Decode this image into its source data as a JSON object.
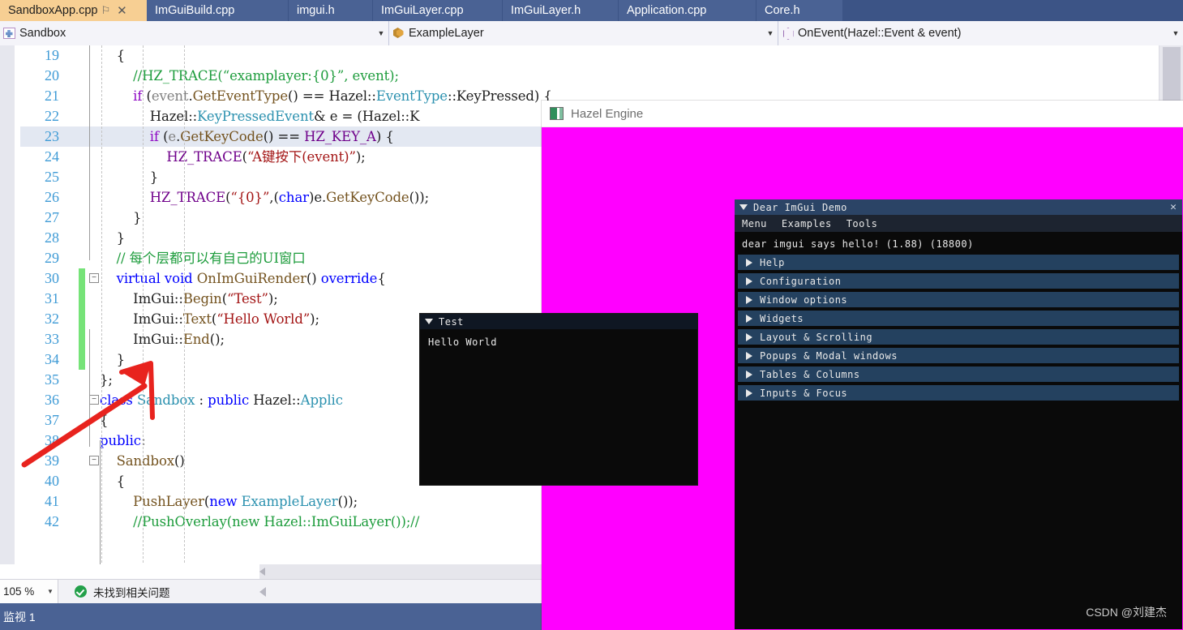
{
  "tabs": [
    {
      "label": "SandboxApp.cpp",
      "active": true,
      "pin": "⚐",
      "close": "✕"
    },
    {
      "label": "ImGuiBuild.cpp",
      "active": false
    },
    {
      "label": "imgui.h",
      "active": false
    },
    {
      "label": "ImGuiLayer.cpp",
      "active": false
    },
    {
      "label": "ImGuiLayer.h",
      "active": false
    },
    {
      "label": "Application.cpp",
      "active": false
    },
    {
      "label": "Core.h",
      "active": false
    }
  ],
  "navbar": {
    "project": {
      "label": "Sandbox",
      "icon": "project-icon",
      "arrow": "▼"
    },
    "class": {
      "label": "ExampleLayer",
      "icon": "class-icon",
      "arrow": "▼"
    },
    "member": {
      "label": "OnEvent(Hazel::Event & event)",
      "icon": "method-icon",
      "arrow": "▼"
    }
  },
  "editor": {
    "lines": [
      {
        "num": "19",
        "indent": 0,
        "fold": "",
        "change": "",
        "highlight": false,
        "tokens": [
          {
            "t": "    {",
            "c": "t-pl"
          }
        ]
      },
      {
        "num": "20",
        "indent": 0,
        "fold": "",
        "change": "",
        "highlight": false,
        "tokens": [
          {
            "t": "        //HZ_TRACE(“examplayer:{0}”, event);",
            "c": "t-cmt"
          }
        ]
      },
      {
        "num": "21",
        "indent": 0,
        "fold": "",
        "change": "",
        "highlight": false,
        "tokens": [
          {
            "t": "        ",
            "c": "t-pl"
          },
          {
            "t": "if",
            "c": "t-ctl"
          },
          {
            "t": " (",
            "c": "t-pl"
          },
          {
            "t": "event",
            "c": "t-var"
          },
          {
            "t": ".",
            "c": "t-pl"
          },
          {
            "t": "GetEventType",
            "c": "t-fn"
          },
          {
            "t": "() == Hazel::",
            "c": "t-pl"
          },
          {
            "t": "EventType",
            "c": "t-type"
          },
          {
            "t": "::KeyPressed) {",
            "c": "t-pl"
          }
        ]
      },
      {
        "num": "22",
        "indent": 0,
        "fold": "",
        "change": "",
        "highlight": false,
        "tokens": [
          {
            "t": "            Hazel::",
            "c": "t-pl"
          },
          {
            "t": "KeyPressedEvent",
            "c": "t-type"
          },
          {
            "t": "& e = (Hazel::K",
            "c": "t-pl"
          }
        ]
      },
      {
        "num": "23",
        "indent": 0,
        "fold": "",
        "change": "",
        "highlight": true,
        "tokens": [
          {
            "t": "            ",
            "c": "t-pl"
          },
          {
            "t": "if",
            "c": "t-ctl"
          },
          {
            "t": " (",
            "c": "t-pl"
          },
          {
            "t": "e",
            "c": "t-var"
          },
          {
            "t": ".",
            "c": "t-pl"
          },
          {
            "t": "GetKeyCode",
            "c": "t-fn"
          },
          {
            "t": "() == ",
            "c": "t-pl"
          },
          {
            "t": "HZ_KEY_A",
            "c": "t-mac"
          },
          {
            "t": ") {",
            "c": "t-pl"
          }
        ]
      },
      {
        "num": "24",
        "indent": 0,
        "fold": "",
        "change": "",
        "highlight": false,
        "tokens": [
          {
            "t": "                ",
            "c": "t-pl"
          },
          {
            "t": "HZ_TRACE",
            "c": "t-mac"
          },
          {
            "t": "(",
            "c": "t-pl"
          },
          {
            "t": "“A键按下(event)”",
            "c": "t-str"
          },
          {
            "t": ");",
            "c": "t-pl"
          }
        ]
      },
      {
        "num": "25",
        "indent": 0,
        "fold": "",
        "change": "",
        "highlight": false,
        "tokens": [
          {
            "t": "            }",
            "c": "t-pl"
          }
        ]
      },
      {
        "num": "26",
        "indent": 0,
        "fold": "",
        "change": "",
        "highlight": false,
        "tokens": [
          {
            "t": "            ",
            "c": "t-pl"
          },
          {
            "t": "HZ_TRACE",
            "c": "t-mac"
          },
          {
            "t": "(",
            "c": "t-pl"
          },
          {
            "t": "“{0}”",
            "c": "t-str"
          },
          {
            "t": ",(",
            "c": "t-pl"
          },
          {
            "t": "char",
            "c": "t-kw"
          },
          {
            "t": ")e.",
            "c": "t-pl"
          },
          {
            "t": "GetKeyCode",
            "c": "t-fn"
          },
          {
            "t": "());",
            "c": "t-pl"
          }
        ]
      },
      {
        "num": "27",
        "indent": 0,
        "fold": "",
        "change": "",
        "highlight": false,
        "tokens": [
          {
            "t": "        }",
            "c": "t-pl"
          }
        ]
      },
      {
        "num": "28",
        "indent": 0,
        "fold": "",
        "change": "",
        "highlight": false,
        "tokens": [
          {
            "t": "    }",
            "c": "t-pl"
          }
        ]
      },
      {
        "num": "29",
        "indent": 0,
        "fold": "",
        "change": "",
        "highlight": false,
        "tokens": [
          {
            "t": "    // 每个层都可以有自己的UI窗口",
            "c": "t-cmt"
          }
        ]
      },
      {
        "num": "30",
        "indent": 0,
        "fold": "−",
        "change": "green",
        "highlight": false,
        "tokens": [
          {
            "t": "    ",
            "c": "t-pl"
          },
          {
            "t": "virtual",
            "c": "t-kw"
          },
          {
            "t": " ",
            "c": "t-pl"
          },
          {
            "t": "void",
            "c": "t-kw"
          },
          {
            "t": " ",
            "c": "t-pl"
          },
          {
            "t": "OnImGuiRender",
            "c": "t-fn"
          },
          {
            "t": "() ",
            "c": "t-pl"
          },
          {
            "t": "override",
            "c": "t-kw"
          },
          {
            "t": "{",
            "c": "t-pl"
          }
        ]
      },
      {
        "num": "31",
        "indent": 0,
        "fold": "",
        "change": "green",
        "highlight": false,
        "tokens": [
          {
            "t": "        ImGui::",
            "c": "t-pl"
          },
          {
            "t": "Begin",
            "c": "t-fn"
          },
          {
            "t": "(",
            "c": "t-pl"
          },
          {
            "t": "“Test”",
            "c": "t-str"
          },
          {
            "t": ");",
            "c": "t-pl"
          }
        ]
      },
      {
        "num": "32",
        "indent": 0,
        "fold": "",
        "change": "green",
        "highlight": false,
        "tokens": [
          {
            "t": "        ImGui::",
            "c": "t-pl"
          },
          {
            "t": "Text",
            "c": "t-fn"
          },
          {
            "t": "(",
            "c": "t-pl"
          },
          {
            "t": "“Hello World”",
            "c": "t-str"
          },
          {
            "t": ");",
            "c": "t-pl"
          }
        ]
      },
      {
        "num": "33",
        "indent": 0,
        "fold": "",
        "change": "green",
        "highlight": false,
        "tokens": [
          {
            "t": "        ImGui::",
            "c": "t-pl"
          },
          {
            "t": "End",
            "c": "t-fn"
          },
          {
            "t": "();",
            "c": "t-pl"
          }
        ]
      },
      {
        "num": "34",
        "indent": 0,
        "fold": "",
        "change": "green",
        "highlight": false,
        "tokens": [
          {
            "t": "    }",
            "c": "t-pl"
          }
        ]
      },
      {
        "num": "35",
        "indent": 0,
        "fold": "",
        "change": "",
        "highlight": false,
        "tokens": [
          {
            "t": "};",
            "c": "t-pl"
          }
        ]
      },
      {
        "num": "36",
        "indent": 0,
        "fold": "−",
        "change": "",
        "highlight": false,
        "tokens": [
          {
            "t": "",
            "c": "t-pl"
          },
          {
            "t": "class",
            "c": "t-kw"
          },
          {
            "t": " ",
            "c": "t-pl"
          },
          {
            "t": "Sandbox",
            "c": "t-type"
          },
          {
            "t": " : ",
            "c": "t-pl"
          },
          {
            "t": "public",
            "c": "t-kw"
          },
          {
            "t": " Hazel::",
            "c": "t-pl"
          },
          {
            "t": "Applic",
            "c": "t-type"
          }
        ]
      },
      {
        "num": "37",
        "indent": 0,
        "fold": "",
        "change": "",
        "highlight": false,
        "tokens": [
          {
            "t": "{",
            "c": "t-pl"
          }
        ]
      },
      {
        "num": "38",
        "indent": 0,
        "fold": "",
        "change": "",
        "highlight": false,
        "tokens": [
          {
            "t": "public",
            "c": "t-kw"
          },
          {
            "t": ":",
            "c": "t-pl"
          }
        ]
      },
      {
        "num": "39",
        "indent": 0,
        "fold": "−",
        "change": "",
        "highlight": false,
        "tokens": [
          {
            "t": "    ",
            "c": "t-pl"
          },
          {
            "t": "Sandbox",
            "c": "t-fn"
          },
          {
            "t": "()",
            "c": "t-pl"
          }
        ]
      },
      {
        "num": "40",
        "indent": 0,
        "fold": "",
        "change": "",
        "highlight": false,
        "tokens": [
          {
            "t": "    {",
            "c": "t-pl"
          }
        ]
      },
      {
        "num": "41",
        "indent": 0,
        "fold": "",
        "change": "",
        "highlight": false,
        "tokens": [
          {
            "t": "        ",
            "c": "t-pl"
          },
          {
            "t": "PushLayer",
            "c": "t-fn"
          },
          {
            "t": "(",
            "c": "t-pl"
          },
          {
            "t": "new",
            "c": "t-kw"
          },
          {
            "t": " ",
            "c": "t-pl"
          },
          {
            "t": "ExampleLayer",
            "c": "t-type"
          },
          {
            "t": "());",
            "c": "t-pl"
          }
        ]
      },
      {
        "num": "42",
        "indent": 0,
        "fold": "",
        "change": "",
        "highlight": false,
        "tokens": [
          {
            "t": "        //PushOverlay(new Hazel::ImGuiLayer());//",
            "c": "t-cmt"
          }
        ]
      }
    ]
  },
  "statusbar": {
    "zoom": "105 %",
    "zoom_arrow": "▼",
    "issues": "未找到相关问题"
  },
  "bottomdock": {
    "tab": "监视 1"
  },
  "hazel_window": {
    "title": "Hazel Engine",
    "clear_color": "#ff00ff"
  },
  "imgui_test_window": {
    "title": "Test",
    "collapse_arrow": "▼",
    "body_text": "Hello World"
  },
  "imgui_demo_window": {
    "title": "Dear ImGui Demo",
    "collapse_arrow": "▼",
    "close_glyph": "✕",
    "menu": [
      "Menu",
      "Examples",
      "Tools"
    ],
    "hello_line": "dear imgui says hello! (1.88) (18800)",
    "headers": [
      "Help",
      "Configuration",
      "Window options",
      "Widgets",
      "Layout & Scrolling",
      "Popups & Modal windows",
      "Tables & Columns",
      "Inputs & Focus"
    ]
  },
  "watermark": "CSDN @刘建杰"
}
